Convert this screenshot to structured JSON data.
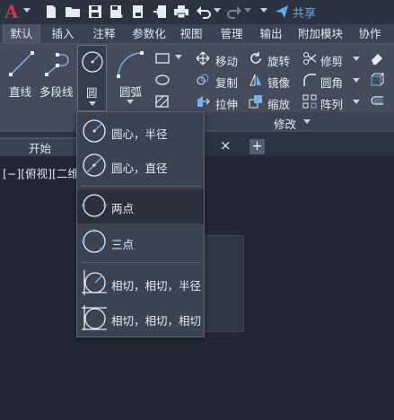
{
  "app": {
    "logo": "A"
  },
  "quick_access": {
    "share_label": "共享"
  },
  "ribbon_tabs": [
    {
      "label": "默认",
      "active": true
    },
    {
      "label": "插入"
    },
    {
      "label": "注释"
    },
    {
      "label": "参数化"
    },
    {
      "label": "视图"
    },
    {
      "label": "管理"
    },
    {
      "label": "输出"
    },
    {
      "label": "附加模块"
    },
    {
      "label": "协作"
    }
  ],
  "draw_panel": {
    "line": "直线",
    "polyline": "多段线",
    "circle": "圆",
    "arc": "圆弧"
  },
  "modify_panel": {
    "title": "修改",
    "move": "移动",
    "rotate": "旋转",
    "trim": "修剪",
    "copy": "复制",
    "mirror": "镜像",
    "fillet": "圆角",
    "stretch": "拉伸",
    "scale": "缩放",
    "array": "阵列"
  },
  "file_tabs": {
    "start": "开始",
    "close": "×",
    "new": "+"
  },
  "viewport": {
    "label": "[−][俯视][二维"
  },
  "circle_menu": [
    {
      "label": "圆心，半径",
      "icon": "circle-center-radius-icon"
    },
    {
      "label": "圆心，直径",
      "icon": "circle-center-diameter-icon"
    },
    {
      "label": "两点",
      "icon": "circle-2point-icon",
      "hover": true
    },
    {
      "label": "三点",
      "icon": "circle-3point-icon"
    },
    {
      "label": "相切，相切，半径",
      "icon": "circle-ttr-icon"
    },
    {
      "label": "相切，相切，相切",
      "icon": "circle-ttt-icon"
    }
  ],
  "colors": {
    "accent": "#5ab0f5",
    "logo_red": "#d6343a",
    "ribbon_bg": "#444b5b",
    "dropdown_bg": "#3b4252"
  }
}
